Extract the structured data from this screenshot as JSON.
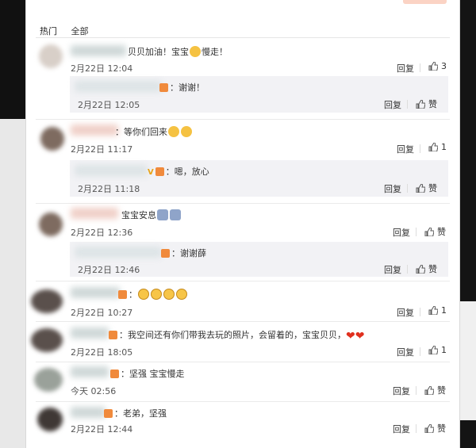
{
  "tabs": [
    "热门",
    "全部"
  ],
  "actions": {
    "reply": "回复",
    "like": "赞"
  },
  "comments": [
    {
      "text": "贝贝加油！宝宝",
      "text2": "慢走！",
      "time": "2月22日 12:04",
      "likes": "3",
      "reply": {
        "text": "：谢谢！",
        "time": "2月22日 12:05"
      }
    },
    {
      "text": "：等你们回来",
      "time": "2月22日 11:17",
      "likes": "1",
      "reply": {
        "text": "：嗯，放心",
        "time": "2月22日 11:18"
      }
    },
    {
      "text": "宝宝安息",
      "time": "2月22日 12:36",
      "likes": "",
      "reply": {
        "text": "：谢谢薛",
        "time": "2月22日 12:46"
      }
    },
    {
      "text": "：",
      "time": "2月22日 10:27",
      "likes": "1"
    },
    {
      "text": "：我空间还有你们带我去玩的照片，会留着的，宝宝贝贝，",
      "time": "2月22日 18:05",
      "likes": "1"
    },
    {
      "text": "：坚强 宝宝慢走",
      "time": "今天 02:56",
      "likes": ""
    },
    {
      "text": "：老弟，坚强",
      "time": "2月22日 12:44",
      "likes": ""
    }
  ],
  "icons": {
    "like": "thumb-up-icon",
    "emoji": "emoji-icon",
    "heart": "heart-icon",
    "badge": "member-badge-icon"
  }
}
